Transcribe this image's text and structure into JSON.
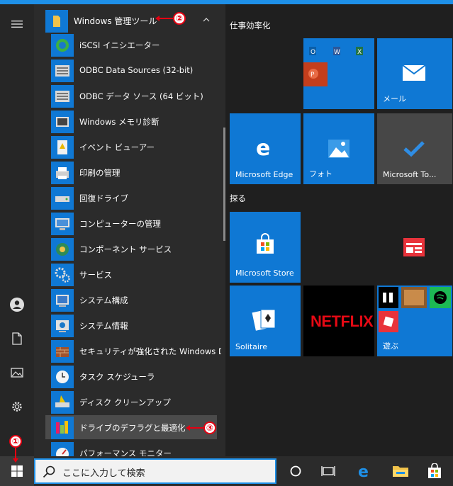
{
  "start_menu": {
    "group_header": "Windows 管理ツール",
    "items": [
      {
        "label": "iSCSI イニシエーター",
        "icon": "iscsi-icon"
      },
      {
        "label": "ODBC Data Sources (32-bit)",
        "icon": "odbc-icon"
      },
      {
        "label": "ODBC データ ソース (64 ビット)",
        "icon": "odbc-icon"
      },
      {
        "label": "Windows メモリ診断",
        "icon": "memory-icon"
      },
      {
        "label": "イベント ビューアー",
        "icon": "event-viewer-icon"
      },
      {
        "label": "印刷の管理",
        "icon": "printer-icon"
      },
      {
        "label": "回復ドライブ",
        "icon": "drive-icon"
      },
      {
        "label": "コンピューターの管理",
        "icon": "computer-management-icon"
      },
      {
        "label": "コンポーネント サービス",
        "icon": "component-services-icon"
      },
      {
        "label": "サービス",
        "icon": "services-gear-icon"
      },
      {
        "label": "システム構成",
        "icon": "system-config-icon"
      },
      {
        "label": "システム情報",
        "icon": "system-info-icon"
      },
      {
        "label": "セキュリティが強化された Windows De...",
        "icon": "firewall-icon"
      },
      {
        "label": "タスク スケジューラ",
        "icon": "clock-icon"
      },
      {
        "label": "ディスク クリーンアップ",
        "icon": "disk-cleanup-icon"
      },
      {
        "label": "ドライブのデフラグと最適化",
        "icon": "defrag-icon"
      },
      {
        "label": "パフォーマンス モニター",
        "icon": "performance-icon"
      }
    ]
  },
  "tiles": {
    "section1": "仕事効率化",
    "section2": "探る",
    "mail": "メール",
    "edge": "Microsoft Edge",
    "photos": "フォト",
    "todo": "Microsoft To...",
    "store": "Microsoft Store",
    "solitaire": "Solitaire",
    "netflix": "NETFLIX",
    "play": "遊ぶ"
  },
  "taskbar": {
    "search_placeholder": "ここに入力して検索"
  },
  "annotations": {
    "c1": "①",
    "c2": "②",
    "c3": "③"
  },
  "colors": {
    "accent": "#0f78d4",
    "callout": "#e60012"
  }
}
